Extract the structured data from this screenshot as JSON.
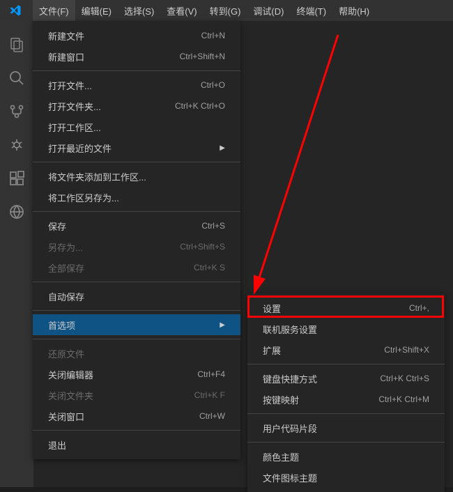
{
  "menubar": {
    "items": [
      {
        "label": "文件(F)"
      },
      {
        "label": "编辑(E)"
      },
      {
        "label": "选择(S)"
      },
      {
        "label": "查看(V)"
      },
      {
        "label": "转到(G)"
      },
      {
        "label": "调试(D)"
      },
      {
        "label": "终端(T)"
      },
      {
        "label": "帮助(H)"
      }
    ]
  },
  "fileMenu": {
    "groups": [
      [
        {
          "label": "新建文件",
          "shortcut": "Ctrl+N"
        },
        {
          "label": "新建窗口",
          "shortcut": "Ctrl+Shift+N"
        }
      ],
      [
        {
          "label": "打开文件...",
          "shortcut": "Ctrl+O"
        },
        {
          "label": "打开文件夹...",
          "shortcut": "Ctrl+K Ctrl+O"
        },
        {
          "label": "打开工作区..."
        },
        {
          "label": "打开最近的文件",
          "submenu": true
        }
      ],
      [
        {
          "label": "将文件夹添加到工作区..."
        },
        {
          "label": "将工作区另存为..."
        }
      ],
      [
        {
          "label": "保存",
          "shortcut": "Ctrl+S"
        },
        {
          "label": "另存为...",
          "shortcut": "Ctrl+Shift+S",
          "disabled": true
        },
        {
          "label": "全部保存",
          "shortcut": "Ctrl+K S",
          "disabled": true
        }
      ],
      [
        {
          "label": "自动保存"
        }
      ],
      [
        {
          "label": "首选项",
          "submenu": true,
          "highlighted": true
        }
      ],
      [
        {
          "label": "还原文件",
          "disabled": true
        },
        {
          "label": "关闭编辑器",
          "shortcut": "Ctrl+F4"
        },
        {
          "label": "关闭文件夹",
          "shortcut": "Ctrl+K F",
          "disabled": true
        },
        {
          "label": "关闭窗口",
          "shortcut": "Ctrl+W"
        }
      ],
      [
        {
          "label": "退出"
        }
      ]
    ]
  },
  "preferencesSubmenu": {
    "groups": [
      [
        {
          "label": "设置",
          "shortcut": "Ctrl+,"
        },
        {
          "label": "联机服务设置"
        },
        {
          "label": "扩展",
          "shortcut": "Ctrl+Shift+X"
        }
      ],
      [
        {
          "label": "键盘快捷方式",
          "shortcut": "Ctrl+K Ctrl+S"
        },
        {
          "label": "按键映射",
          "shortcut": "Ctrl+K Ctrl+M"
        }
      ],
      [
        {
          "label": "用户代码片段"
        }
      ],
      [
        {
          "label": "颜色主题"
        },
        {
          "label": "文件图标主题"
        }
      ]
    ]
  }
}
